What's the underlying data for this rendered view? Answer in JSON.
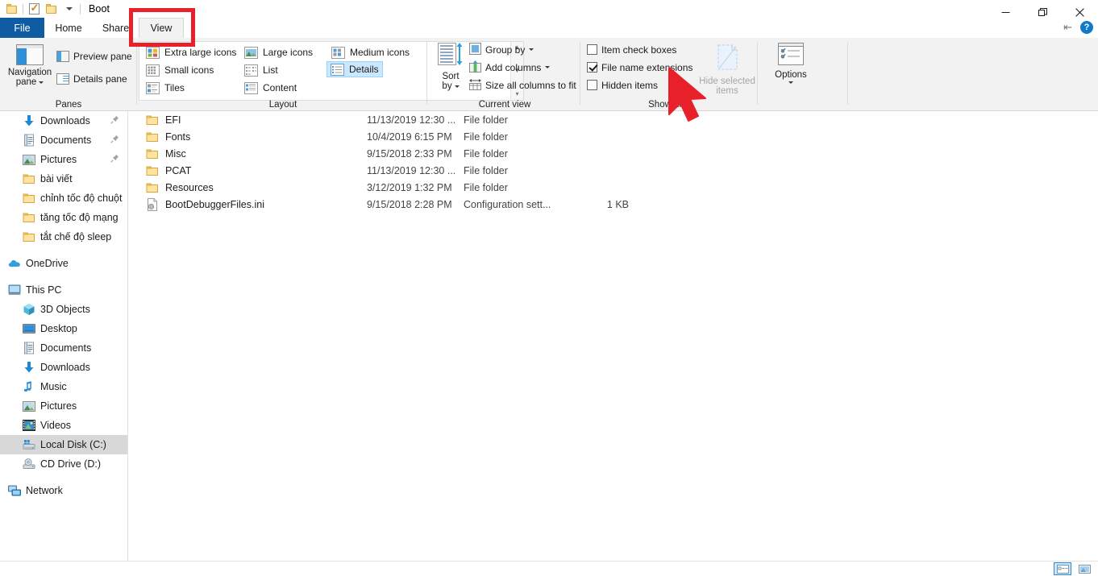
{
  "window": {
    "title": "Boot",
    "quick_access": [
      {
        "name": "folder-icon",
        "label": "Folder"
      },
      {
        "name": "properties-icon",
        "label": "Properties"
      },
      {
        "name": "new-folder-icon",
        "label": "New folder"
      },
      {
        "name": "customize-qat-icon",
        "label": "Customize Quick Access Toolbar"
      }
    ],
    "controls": {
      "minimize": "Minimize",
      "restore": "Restore Down",
      "close": "Close"
    }
  },
  "tabs": {
    "file": "File",
    "home": "Home",
    "share": "Share",
    "view": "View",
    "active": "View"
  },
  "ribbon_right": {
    "collapse": "Collapse the Ribbon",
    "help": "?"
  },
  "ribbon": {
    "groups": [
      {
        "id": "panes",
        "label": "Panes"
      },
      {
        "id": "layout",
        "label": "Layout"
      },
      {
        "id": "current_view",
        "label": "Current view"
      },
      {
        "id": "show_hide",
        "label": "Show/hide"
      },
      {
        "id": "options",
        "label": ""
      }
    ],
    "panes": {
      "navigation_pane": "Navigation\npane",
      "navigation_pane_line1": "Navigation",
      "navigation_pane_line2": "pane",
      "preview_pane": "Preview pane",
      "details_pane": "Details pane"
    },
    "layout": {
      "items": [
        {
          "label": "Extra large icons",
          "selected": false
        },
        {
          "label": "Large icons",
          "selected": false
        },
        {
          "label": "Medium icons",
          "selected": false
        },
        {
          "label": "Small icons",
          "selected": false
        },
        {
          "label": "List",
          "selected": false
        },
        {
          "label": "Details",
          "selected": true
        },
        {
          "label": "Tiles",
          "selected": false
        },
        {
          "label": "Content",
          "selected": false
        }
      ]
    },
    "current_view": {
      "sort_by_line1": "Sort",
      "sort_by_line2": "by",
      "group_by": "Group by",
      "add_columns": "Add columns",
      "size_all_columns": "Size all columns to fit"
    },
    "show_hide": {
      "item_check_boxes": {
        "label": "Item check boxes",
        "checked": false
      },
      "file_name_extensions": {
        "label": "File name extensions",
        "checked": true
      },
      "hidden_items": {
        "label": "Hidden items",
        "checked": false
      },
      "hide_selected_items_line1": "Hide selected",
      "hide_selected_items_line2": "items"
    },
    "options": {
      "label": "Options"
    }
  },
  "sidebar": {
    "items": [
      {
        "label": "Downloads",
        "icon": "download-arrow-icon",
        "indent": 1,
        "pinned": true,
        "selected": false
      },
      {
        "label": "Documents",
        "icon": "documents-icon",
        "indent": 1,
        "pinned": true,
        "selected": false
      },
      {
        "label": "Pictures",
        "icon": "pictures-icon",
        "indent": 1,
        "pinned": true,
        "selected": false
      },
      {
        "label": "bài viết",
        "icon": "folder-icon",
        "indent": 1,
        "pinned": false,
        "selected": false
      },
      {
        "label": "chỉnh tốc độ chuột",
        "icon": "folder-icon",
        "indent": 1,
        "pinned": false,
        "selected": false
      },
      {
        "label": "tăng tốc độ mạng",
        "icon": "folder-icon",
        "indent": 1,
        "pinned": false,
        "selected": false
      },
      {
        "label": "tắt chế độ sleep",
        "icon": "folder-icon",
        "indent": 1,
        "pinned": false,
        "selected": false
      },
      {
        "label": "GAP",
        "icon": "",
        "indent": 0,
        "pinned": false,
        "selected": false
      },
      {
        "label": "OneDrive",
        "icon": "onedrive-icon",
        "indent": 0,
        "pinned": false,
        "selected": false
      },
      {
        "label": "GAP",
        "icon": "",
        "indent": 0,
        "pinned": false,
        "selected": false
      },
      {
        "label": "This PC",
        "icon": "this-pc-icon",
        "indent": 0,
        "pinned": false,
        "selected": false
      },
      {
        "label": "3D Objects",
        "icon": "3d-objects-icon",
        "indent": 1,
        "pinned": false,
        "selected": false
      },
      {
        "label": "Desktop",
        "icon": "desktop-icon",
        "indent": 1,
        "pinned": false,
        "selected": false
      },
      {
        "label": "Documents",
        "icon": "documents-icon",
        "indent": 1,
        "pinned": false,
        "selected": false
      },
      {
        "label": "Downloads",
        "icon": "download-arrow-icon",
        "indent": 1,
        "pinned": false,
        "selected": false
      },
      {
        "label": "Music",
        "icon": "music-icon",
        "indent": 1,
        "pinned": false,
        "selected": false
      },
      {
        "label": "Pictures",
        "icon": "pictures-icon",
        "indent": 1,
        "pinned": false,
        "selected": false
      },
      {
        "label": "Videos",
        "icon": "videos-icon",
        "indent": 1,
        "pinned": false,
        "selected": false
      },
      {
        "label": "Local Disk (C:)",
        "icon": "drive-icon",
        "indent": 1,
        "pinned": false,
        "selected": true
      },
      {
        "label": "CD Drive (D:)",
        "icon": "cd-drive-icon",
        "indent": 1,
        "pinned": false,
        "selected": false
      },
      {
        "label": "GAP",
        "icon": "",
        "indent": 0,
        "pinned": false,
        "selected": false
      },
      {
        "label": "Network",
        "icon": "network-icon",
        "indent": 0,
        "pinned": false,
        "selected": false
      }
    ]
  },
  "filelist": {
    "rows": [
      {
        "name": "EFI",
        "date": "11/13/2019 12:30 ...",
        "type": "File folder",
        "size": "",
        "icon": "folder-icon"
      },
      {
        "name": "Fonts",
        "date": "10/4/2019 6:15 PM",
        "type": "File folder",
        "size": "",
        "icon": "folder-icon"
      },
      {
        "name": "Misc",
        "date": "9/15/2018 2:33 PM",
        "type": "File folder",
        "size": "",
        "icon": "folder-icon"
      },
      {
        "name": "PCAT",
        "date": "11/13/2019 12:30 ...",
        "type": "File folder",
        "size": "",
        "icon": "folder-icon"
      },
      {
        "name": "Resources",
        "date": "3/12/2019 1:32 PM",
        "type": "File folder",
        "size": "",
        "icon": "folder-icon"
      },
      {
        "name": "BootDebuggerFiles.ini",
        "date": "9/15/2018 2:28 PM",
        "type": "Configuration sett...",
        "size": "1 KB",
        "icon": "ini-file-icon"
      }
    ]
  },
  "statusbar": {
    "item_count": "",
    "view_details": "Details view",
    "view_large_icons": "Large icons view"
  },
  "annotations": {
    "highlight_target": "View",
    "arrow_target": "File name extensions",
    "color": "#e8202a"
  }
}
